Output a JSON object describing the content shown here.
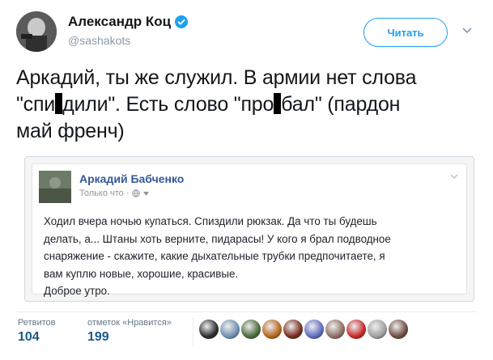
{
  "tweet": {
    "author_name": "Александр Коц",
    "handle": "@sashakots",
    "follow_label": "Читать",
    "text_lines": [
      [
        "Аркадий, ты же служил. В армии нет слова"
      ],
      [
        "\"спи",
        "дили\". Есть слово \"про",
        "бал\" (пардон"
      ],
      [
        "май френч)"
      ]
    ]
  },
  "quoted_post": {
    "author_name": "Аркадий Бабченко",
    "meta": "Только что ·",
    "text_lines": [
      "Ходил вчера ночью купаться. Спиздили рюкзак. Да что ты будешь",
      "делать, а... Штаны хоть верните, пидарасы! У кого я брал подводное",
      "снаряжение - скажите, какие дыхательные трубки предпочитаете, я",
      "вам куплю новые, хорошие, красивые.",
      "Доброе утро."
    ]
  },
  "stats": {
    "retweets_label": "Ретвитов",
    "retweets_value": "104",
    "likes_label": "отметок «Нравится»",
    "likes_value": "199"
  },
  "likers": [
    {
      "name": "liker-avatar-1",
      "color": "#2b2b2b"
    },
    {
      "name": "liker-avatar-2",
      "color": "#6f8fb0"
    },
    {
      "name": "liker-avatar-3",
      "color": "#4a6a3a"
    },
    {
      "name": "liker-avatar-4",
      "color": "#b5651d"
    },
    {
      "name": "liker-avatar-5",
      "color": "#7a2a1e"
    },
    {
      "name": "liker-avatar-6",
      "color": "#5c6bc0"
    },
    {
      "name": "liker-avatar-7",
      "color": "#8d6e63"
    },
    {
      "name": "liker-avatar-8",
      "color": "#c62828"
    },
    {
      "name": "liker-avatar-9",
      "color": "#9e9e9e"
    },
    {
      "name": "liker-avatar-10",
      "color": "#6d4c41"
    }
  ],
  "colors": {
    "accent": "#1da1f2",
    "fb_link": "#365899",
    "stat_value": "#1c5a87"
  }
}
